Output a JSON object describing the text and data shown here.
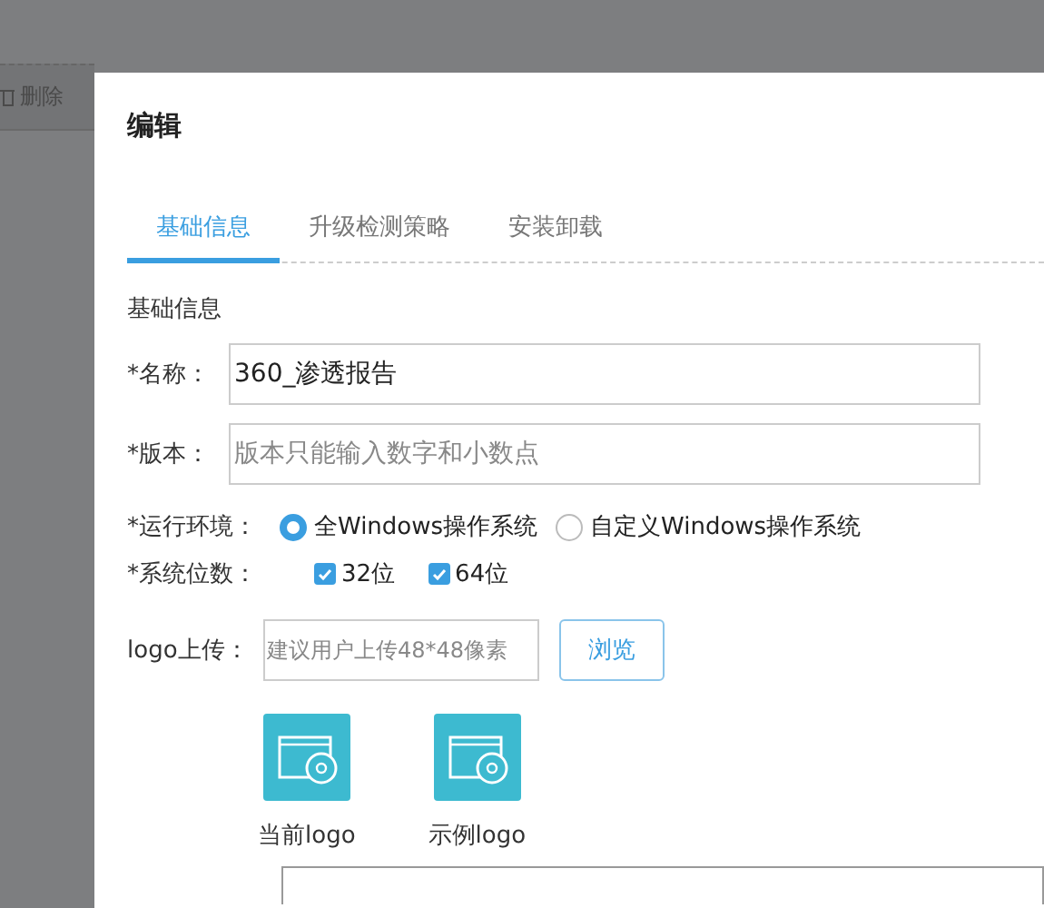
{
  "background": {
    "delete_button": "删除"
  },
  "dialog": {
    "title": "编辑",
    "tabs": [
      {
        "label": "基础信息",
        "selected": true
      },
      {
        "label": "升级检测策略",
        "selected": false
      },
      {
        "label": "安装卸载",
        "selected": false
      }
    ],
    "section_title": "基础信息",
    "fields": [
      {
        "label": "*名称：",
        "value": "360_渗透报告"
      },
      {
        "label": "*版本：",
        "placeholder": "版本只能输入数字和小数点"
      }
    ],
    "environment": {
      "label": "*运行环境：",
      "options": [
        {
          "label": "全Windows操作系统",
          "selected": true
        },
        {
          "label": "自定义Windows操作系统",
          "selected": false
        }
      ]
    },
    "bits": {
      "label": "*系统位数：",
      "options": [
        {
          "label": "32位",
          "checked": true
        },
        {
          "label": "64位",
          "checked": true
        }
      ]
    },
    "logo_upload": {
      "label": "logo上传：",
      "placeholder": "建议用户上传48*48像素",
      "button": "浏览"
    },
    "logos": [
      {
        "caption": "当前logo"
      },
      {
        "caption": "示例logo"
      }
    ]
  }
}
